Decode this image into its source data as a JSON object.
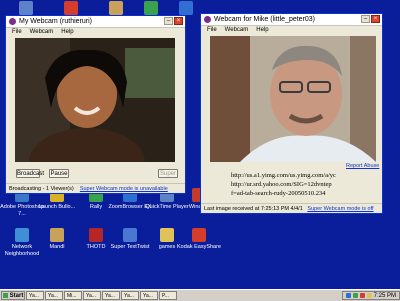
{
  "desktop": {
    "icons": [
      {
        "label": "Adobe Photoshop 7...",
        "color": "#3a78c9"
      },
      {
        "label": "Launch Bullo...",
        "color": "#d8b02a"
      },
      {
        "label": "Rally",
        "color": "#3aa24d"
      },
      {
        "label": "ZoomBrowser EX",
        "color": "#2f6fd1"
      },
      {
        "label": "QuickTime Player",
        "color": "#5c82c7"
      },
      {
        "label": "Winamp",
        "color": "#c23b2c"
      },
      {
        "label": "Network Neighborhood",
        "color": "#3f8fd6"
      },
      {
        "label": "Mandl",
        "color": "#c8a15a"
      },
      {
        "label": "THOTD",
        "color": "#b52626"
      },
      {
        "label": "Super TextTwist",
        "color": "#4a77d1"
      },
      {
        "label": "games",
        "color": "#e0c25a"
      },
      {
        "label": "Kodak EasyShare",
        "color": "#d43c2c"
      }
    ]
  },
  "window_left": {
    "title": "My Webcam (ruthieruri)",
    "menu": [
      "File",
      "Webcam",
      "Help"
    ],
    "broadcast_button": "Broadcast",
    "pause_button": "Pause",
    "super_button": "Super",
    "status_text": "Broadcasting - 1 Viewer(s)",
    "status_link": "Super Webcam mode is unavailable"
  },
  "window_right": {
    "title": "Webcam for Mike (little_peter03)",
    "menu": [
      "File",
      "Webcam",
      "Help"
    ],
    "report_abuse": "Report Abuse",
    "url_line1": "http://us.a1.yimg.com/us.yimg.com/a/yc",
    "url_line2": "http://ur.srd.yahoo.com/SIG=12dvntep",
    "url_line3": "f=ad-tab-search-rudy-20050510.234",
    "status_text": "Last image received at 7:25:13 PM 4/4/1",
    "status_link": "Super Webcam mode is off"
  },
  "taskbar": {
    "start_label": "Start",
    "tasks": [
      "Ya...",
      "Ya...",
      "Mi...",
      "Ya...",
      "Ya...",
      "Ya...",
      "Ya...",
      "P..."
    ],
    "clock": "7:25 PM",
    "tray_colors": [
      "#2c6ed6",
      "#3aa24d",
      "#d43c2c",
      "#e0c25a"
    ]
  }
}
